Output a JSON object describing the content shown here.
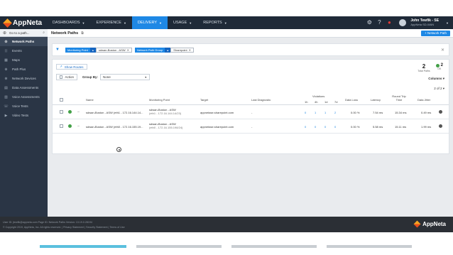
{
  "brand": {
    "name": "AppNeta"
  },
  "topnav": {
    "items": [
      {
        "label": "DASHBOARDS",
        "active": false
      },
      {
        "label": "EXPERIENCE",
        "active": false
      },
      {
        "label": "DELIVERY",
        "active": true
      },
      {
        "label": "USAGE",
        "active": false
      },
      {
        "label": "REPORTS",
        "active": false
      }
    ],
    "icons": [
      "gear-icon",
      "help-icon",
      "alert-icon"
    ]
  },
  "user": {
    "name": "John Tewfik - SE",
    "org": "AppNeta SD-WAN"
  },
  "sidebar": {
    "search_placeholder": "Go to a path...",
    "items": [
      {
        "label": "Network Paths",
        "icon": "network-paths-icon",
        "active": true
      },
      {
        "label": "Events",
        "icon": "events-icon",
        "active": false
      },
      {
        "label": "Maps",
        "icon": "maps-icon",
        "active": false
      },
      {
        "label": "Path Plus",
        "icon": "path-plus-icon",
        "active": false
      },
      {
        "label": "Network Devices",
        "icon": "network-devices-icon",
        "active": false
      },
      {
        "label": "Data Assessments",
        "icon": "data-assessments-icon",
        "active": false
      },
      {
        "label": "Voice Assessments",
        "icon": "voice-assessments-icon",
        "active": false
      },
      {
        "label": "Voice Tests",
        "icon": "voice-tests-icon",
        "active": false
      },
      {
        "label": "Video Tests",
        "icon": "video-tests-icon",
        "active": false
      }
    ]
  },
  "page": {
    "title": "Network Paths",
    "new_button": "+ Network Path"
  },
  "filters": [
    {
      "key": "Monitoring Point",
      "value": "sdwan-Boston - ASW"
    },
    {
      "key": "Network Path Group",
      "value": "Sharepoint"
    }
  ],
  "toolbar": {
    "show_routes": "Show Routes",
    "action": "Action",
    "group_by_label": "Group By:",
    "group_by_value": "None",
    "columns": "Columns",
    "pager": "2 of 2"
  },
  "summary": {
    "total": "2",
    "total_label": "Total Paths",
    "ok": "2",
    "ok_label": "OK"
  },
  "table": {
    "headers": {
      "name": "Name",
      "monitoring_point": "Monitoring Point",
      "target": "Target",
      "last_diagnostic": "Last Diagnostic",
      "violations": "Violations",
      "v1": "1h",
      "v2": "4h",
      "v3": "1d",
      "v4": "7d",
      "data_loss": "Data Loss",
      "latency": "Latency",
      "round_trip": "Round Trip Time",
      "data_jitter": "Data Jitter"
    },
    "rows": [
      {
        "name": "sdwan-Boston - ASW (eth1 - 172.16.144.14...",
        "mp_name": "sdwan-Boston - ASW",
        "mp_sub": "(eth1 - 172.16.144.14/23)",
        "target": "appnetase.sharepoint.com",
        "last_diagnostic": "-",
        "v1": "0",
        "v2": "1",
        "v3": "1",
        "v4": "2",
        "data_loss": "0.00 %",
        "latency": "7.54 ms",
        "round_trip": "15.34 ms",
        "data_jitter": "0.49 ms"
      },
      {
        "name": "sdwan-Boston - ASW (eth0 - 172.16.155.19...",
        "mp_name": "sdwan-Boston - ASW",
        "mp_sub": "(eth0 - 172.16.155.198/24)",
        "target": "appnetase.sharepoint.com",
        "last_diagnostic": "-",
        "v1": "0",
        "v2": "0",
        "v3": "0",
        "v4": "0",
        "data_loss": "0.00 %",
        "latency": "5.58 ms",
        "round_trip": "15.11 ms",
        "data_jitter": "1.99 ms"
      }
    ]
  },
  "footer": {
    "line1": "User ID: jtewfik@appneta.com      Page ID: Network Paths      Version: 13.19.0.28194",
    "line2": "© Copyright 2019, AppNeta, Inc. All rights reserved.  |  Privacy Statement  |  Security Statement  |  Terms of Use",
    "brand": "AppNeta"
  },
  "colors": {
    "accent": "#1e88e5",
    "topbar": "#1f2a38",
    "sidebar": "#2a3545",
    "ok": "#43a047",
    "alert": "#e53935",
    "progress_active": "#5bc0de"
  }
}
